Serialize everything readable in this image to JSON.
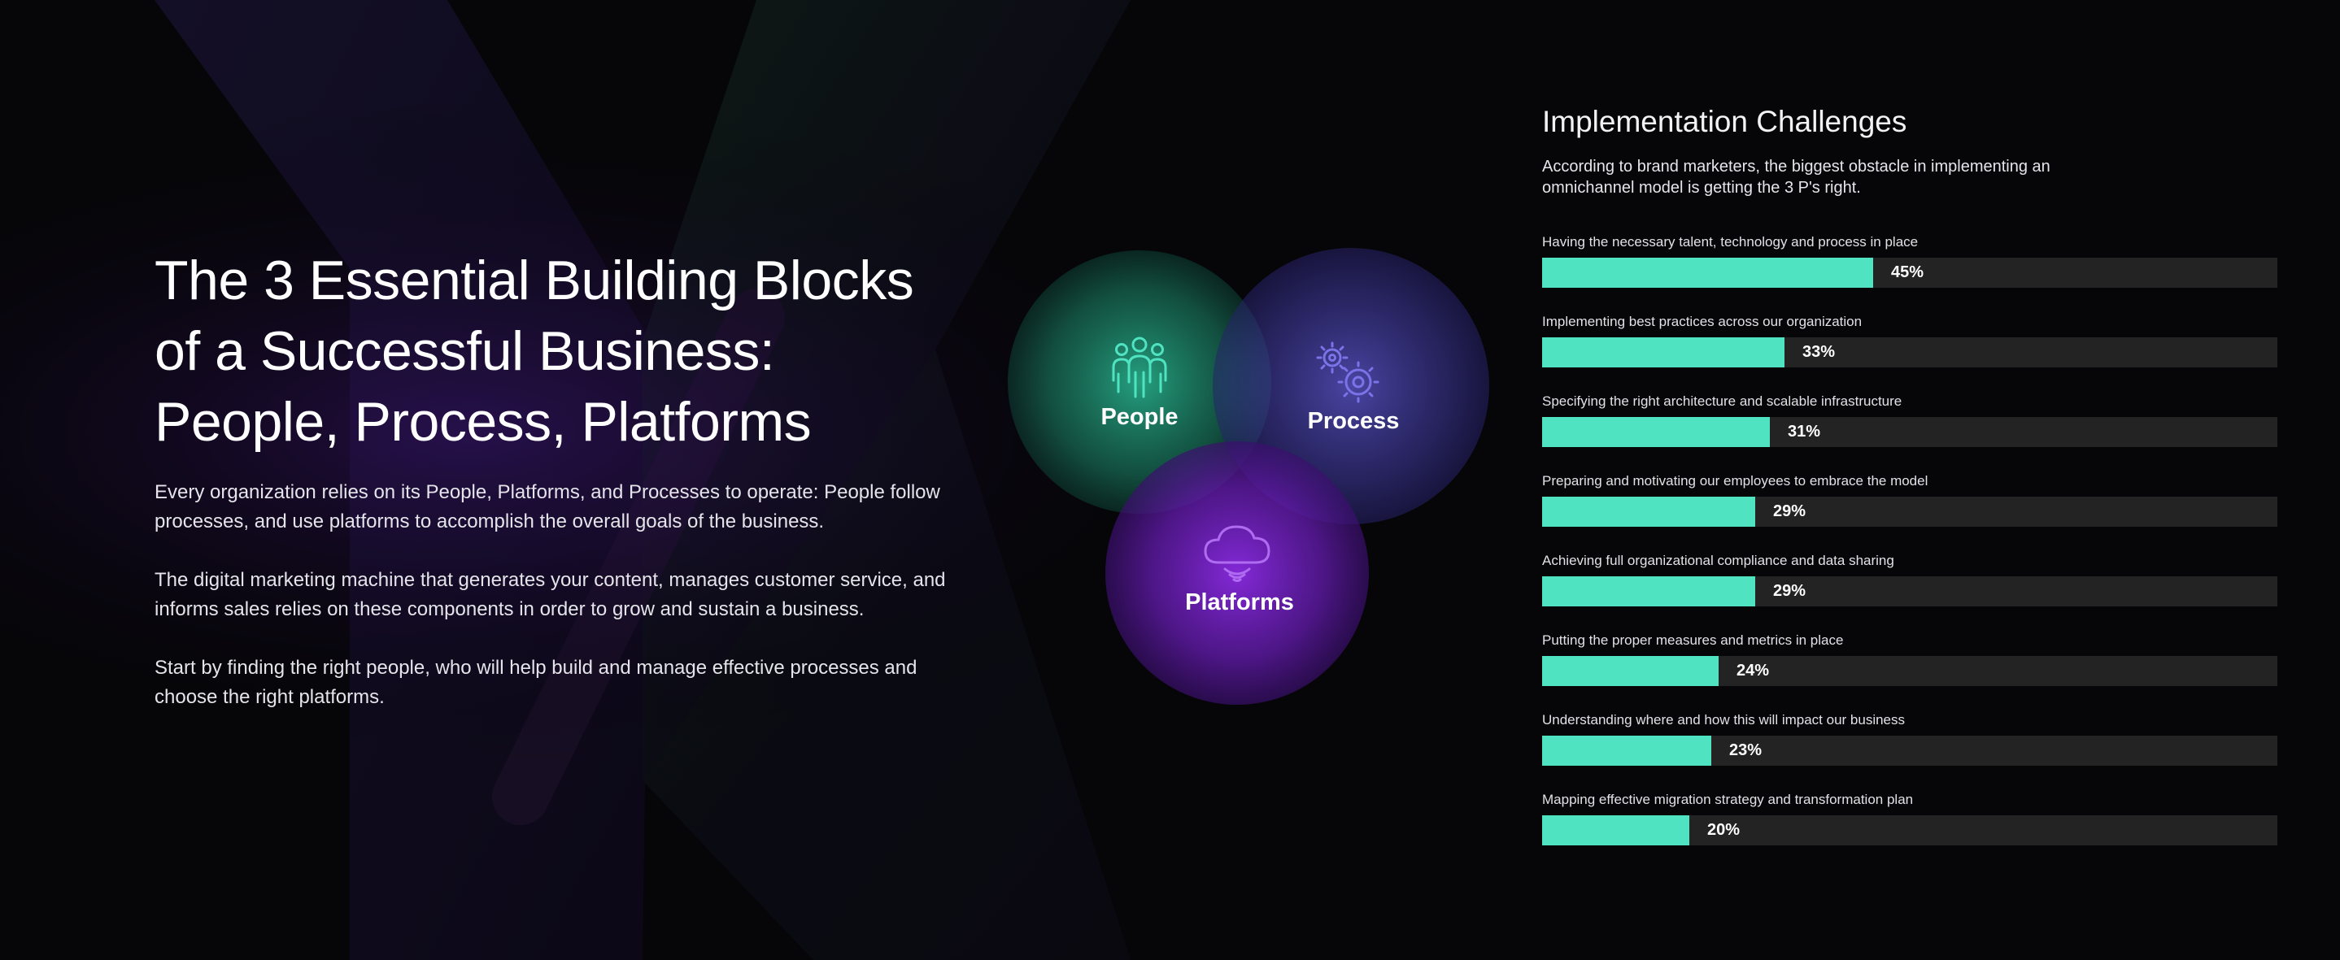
{
  "left": {
    "title_lines": [
      "The 3 Essential Building Blocks",
      "of a Successful Business:",
      "People, Process, Platforms"
    ],
    "paragraphs": [
      "Every organization relies on its People, Platforms, and Processes to operate: People follow processes, and use platforms to accomplish the overall goals of the business.",
      "The digital marketing machine that generates your content, manages customer service, and informs sales relies on these components in order to grow and sustain a business.",
      "Start by finding the right people, who will help build and manage effective processes and choose the right platforms."
    ]
  },
  "venn": {
    "people": {
      "label": "People",
      "icon": "people-icon",
      "color": "#2fd3a6"
    },
    "process": {
      "label": "Process",
      "icon": "gears-icon",
      "color": "#6d63d8"
    },
    "platforms": {
      "label": "Platforms",
      "icon": "cloud-icon",
      "color": "#8a2be2"
    }
  },
  "chart_data": {
    "type": "bar",
    "orientation": "horizontal",
    "title": "Implementation Challenges",
    "subtitle": "According to brand marketers, the biggest obstacle in implementing an omnichannel model is getting the 3 P's right.",
    "categories": [
      "Having the necessary talent, technology and process in place",
      "Implementing best practices across our organization",
      "Specifying the right architecture and scalable infrastructure",
      "Preparing and motivating our employees to embrace the model",
      "Achieving full organizational compliance and data sharing",
      "Putting the proper measures and metrics in place",
      "Understanding where and how this will impact our business",
      "Mapping effective migration strategy and transformation plan"
    ],
    "values": [
      45,
      33,
      31,
      29,
      29,
      24,
      23,
      20
    ],
    "value_labels": [
      "45%",
      "33%",
      "31%",
      "29%",
      "29%",
      "24%",
      "23%",
      "20%"
    ],
    "xlim": [
      0,
      100
    ],
    "grid": false,
    "legend": "none",
    "bar_color": "#4fe3c2",
    "track_color": "#232323"
  }
}
